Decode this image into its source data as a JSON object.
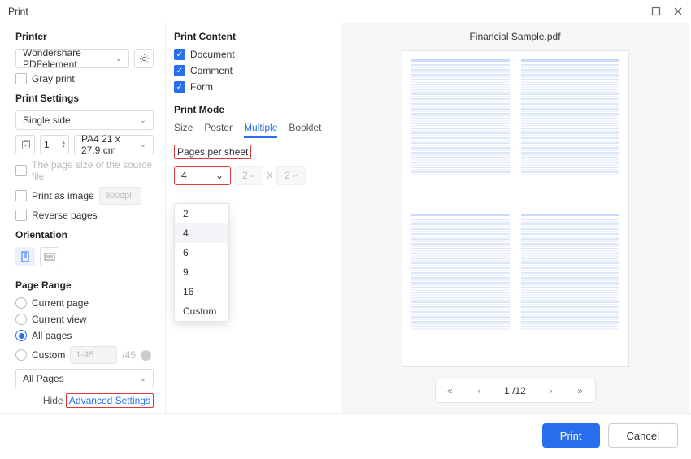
{
  "window": {
    "title": "Print"
  },
  "printer": {
    "section": "Printer",
    "selected": "Wondershare PDFelement",
    "gray_print": "Gray print"
  },
  "settings": {
    "section": "Print Settings",
    "side": "Single side",
    "copies": "1",
    "paper": "PA4 21 x 27.9 cm",
    "source_file": "The page size of the source file",
    "print_as_image": "Print as image",
    "print_as_image_dpi": "300dpi",
    "reverse": "Reverse pages"
  },
  "orientation": {
    "section": "Orientation"
  },
  "range": {
    "section": "Page Range",
    "current_page": "Current page",
    "current_view": "Current view",
    "all_pages": "All pages",
    "custom": "Custom",
    "custom_hint": "1-45",
    "total": "/45",
    "subset": "All Pages"
  },
  "advanced": {
    "hide": "Hide",
    "link": "Advanced Settings"
  },
  "content": {
    "section": "Print Content",
    "document": "Document",
    "comment": "Comment",
    "form": "Form"
  },
  "mode": {
    "section": "Print Mode",
    "tabs": {
      "size": "Size",
      "poster": "Poster",
      "multiple": "Multiple",
      "booklet": "Booklet"
    },
    "pps_label": "Pages per sheet",
    "pps_value": "4",
    "dim_a": "2",
    "dim_x": "X",
    "dim_b": "2",
    "options": {
      "o2": "2",
      "o4": "4",
      "o6": "6",
      "o9": "9",
      "o16": "16",
      "custom": "Custom"
    }
  },
  "preview": {
    "filename": "Financial Sample.pdf",
    "nav": {
      "first": "«",
      "prev": "‹",
      "page": "1 /12",
      "next": "›",
      "last": "»"
    }
  },
  "footer": {
    "print": "Print",
    "cancel": "Cancel"
  }
}
